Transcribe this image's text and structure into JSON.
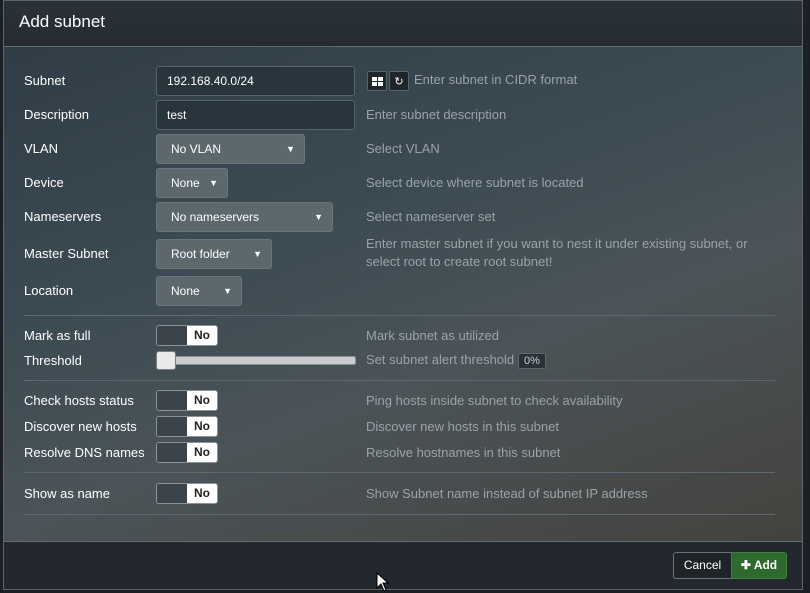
{
  "dialog": {
    "title": "Add subnet"
  },
  "subnet": {
    "label": "Subnet",
    "value": "192.168.40.0/24",
    "hint": "Enter subnet in CIDR format",
    "calc_icon": "grid-icon",
    "refresh_icon": "refresh-icon"
  },
  "description": {
    "label": "Description",
    "value": "test",
    "hint": "Enter subnet description"
  },
  "vlan": {
    "label": "VLAN",
    "selected": "No VLAN",
    "hint": "Select VLAN"
  },
  "device": {
    "label": "Device",
    "selected": "None",
    "hint": "Select device where subnet is located"
  },
  "nameservers": {
    "label": "Nameservers",
    "selected": "No nameservers",
    "hint": "Select nameserver set"
  },
  "master_subnet": {
    "label": "Master Subnet",
    "selected": "Root folder",
    "hint_line1": "Enter master subnet if you want to nest it under existing subnet, or",
    "hint_line2": "select root to create root subnet!"
  },
  "location": {
    "label": "Location",
    "selected": "None"
  },
  "mark_full": {
    "label": "Mark as full",
    "toggle": "No",
    "hint": "Mark subnet as utilized"
  },
  "threshold": {
    "label": "Threshold",
    "hint": "Set subnet alert threshold",
    "value": "0%",
    "level": 0
  },
  "check_hosts": {
    "label": "Check hosts status",
    "toggle": "No",
    "hint": "Ping hosts inside subnet to check availability"
  },
  "discover_hosts": {
    "label": "Discover new hosts",
    "toggle": "No",
    "hint": "Discover new hosts in this subnet"
  },
  "resolve_dns": {
    "label": "Resolve DNS names",
    "toggle": "No",
    "hint": "Resolve hostnames in this subnet"
  },
  "show_name": {
    "label": "Show as name",
    "toggle": "No",
    "hint": "Show Subnet name instead of subnet IP address"
  },
  "footer": {
    "cancel_label": "Cancel",
    "add_label": "Add",
    "add_icon": "plus-icon"
  },
  "colors": {
    "add_button": "#2e6a2e",
    "hint_text": "#9aa3a8"
  }
}
